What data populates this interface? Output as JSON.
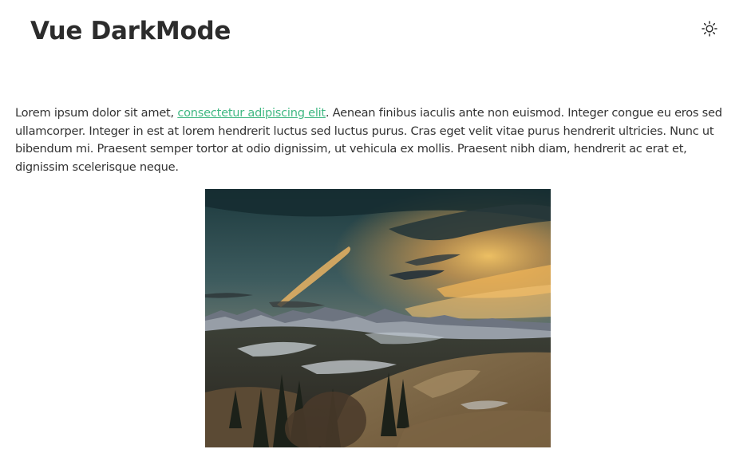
{
  "header": {
    "title": "Vue DarkMode",
    "theme_toggle_icon": "sun-icon"
  },
  "content": {
    "paragraph_before_link": "Lorem ipsum dolor sit amet, ",
    "link_text": "consectetur adipiscing elit",
    "paragraph_after_link": ". Aenean finibus iaculis ante non euismod. Integer congue eu eros sed ullamcorper. Integer in est at lorem hendrerit luctus sed luctus purus. Cras eget velit vitae purus hendrerit ultricies. Nunc ut bibendum mi. Praesent semper tortor at odio dignissim, ut vehicula ex mollis. Praesent nibh diam, hendrerit ac erat et, dignissim scelerisque neque.",
    "link_color": "#41b883",
    "image_icon": "mountain-landscape-photo"
  }
}
